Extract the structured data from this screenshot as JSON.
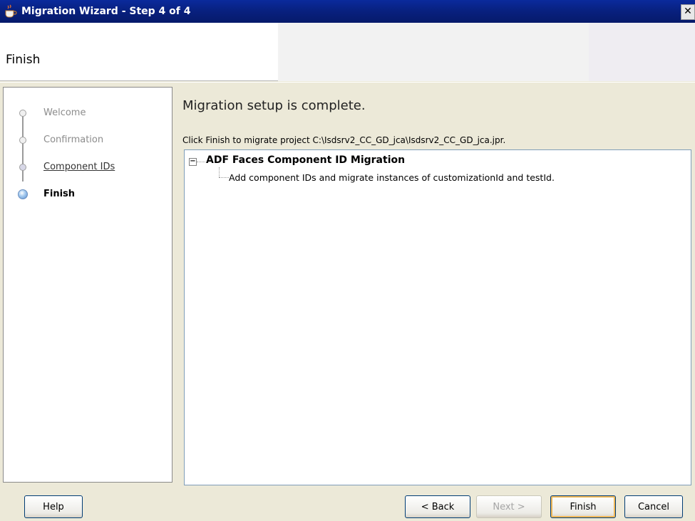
{
  "window": {
    "title": "Migration Wizard - Step 4 of 4",
    "close_glyph": "✕"
  },
  "header": {
    "title": "Finish"
  },
  "nav": {
    "items": [
      {
        "label": "Welcome",
        "state": "done"
      },
      {
        "label": "Confirmation",
        "state": "done"
      },
      {
        "label": "Component IDs",
        "state": "link"
      },
      {
        "label": "Finish",
        "state": "active"
      }
    ]
  },
  "content": {
    "heading": "Migration setup is complete.",
    "description": "Click Finish to migrate project C:\\Isdsrv2_CC_GD_jca\\Isdsrv2_CC_GD_jca.jpr."
  },
  "tree": {
    "toggle_glyph": "−",
    "root": "ADF Faces Component ID Migration",
    "child": "Add component IDs and migrate instances of customizationId and testId."
  },
  "footer": {
    "help": "Help",
    "back": "< Back",
    "next": "Next >",
    "finish": "Finish",
    "cancel": "Cancel"
  },
  "colors": {
    "titlebar": "#08207e",
    "accent_default_button": "#f0b858"
  }
}
